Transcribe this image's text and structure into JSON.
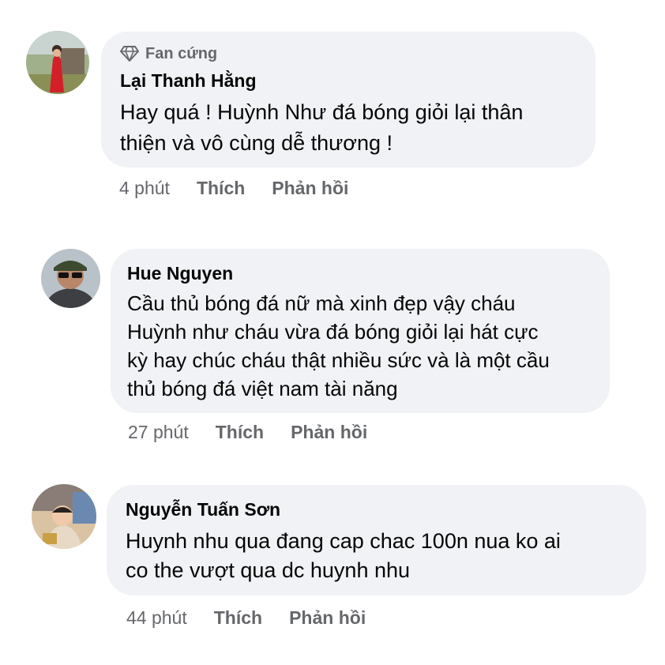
{
  "comments": [
    {
      "badge": "Fan cứng",
      "author": "Lại Thanh Hằng",
      "text_lines": [
        "Hay quá ! Huỳnh Như đá bóng giỏi lại thân",
        "thiện và vô cùng dễ thương !"
      ],
      "time": "4 phút",
      "like_label": "Thích",
      "reply_label": "Phản hồi"
    },
    {
      "author": "Hue Nguyen",
      "text_lines": [
        "Cầu thủ bóng đá nữ mà xinh đẹp vậy cháu",
        "Huỳnh như cháu vừa đá bóng giỏi lại hát cực",
        "kỳ hay chúc cháu thật nhiều sức và là một cầu",
        "thủ bóng đá việt nam tài năng"
      ],
      "time": "27 phút",
      "like_label": "Thích",
      "reply_label": "Phản hồi"
    },
    {
      "author": "Nguyễn Tuấn Sơn",
      "text_lines": [
        "Huynh nhu qua đang cap chac 100n nua ko ai",
        "co the vượt qua dc huynh nhu"
      ],
      "time": "44 phút",
      "like_label": "Thích",
      "reply_label": "Phản hồi"
    }
  ],
  "icons": {
    "badge_icon": "diamond-icon"
  },
  "colors": {
    "bubble_bg": "#f0f2f5",
    "secondary_text": "#65676b",
    "primary_text": "#050505"
  }
}
